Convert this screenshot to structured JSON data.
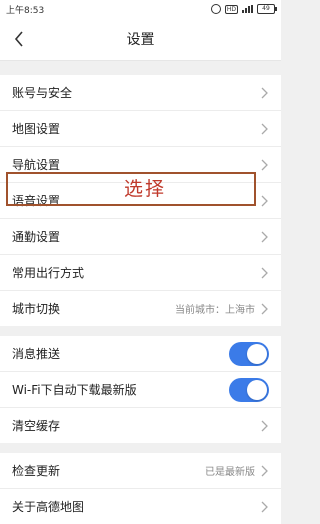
{
  "status_bar": {
    "time": "上午8:53",
    "hd_label": "HD",
    "battery": "49"
  },
  "header": {
    "title": "设置"
  },
  "groups": [
    {
      "rows": [
        {
          "label": "账号与安全"
        },
        {
          "label": "地图设置"
        },
        {
          "label": "导航设置"
        },
        {
          "label": "语音设置"
        },
        {
          "label": "通勤设置"
        },
        {
          "label": "常用出行方式"
        },
        {
          "label": "城市切换",
          "value": "当前城市：上海市"
        }
      ]
    },
    {
      "rows": [
        {
          "label": "消息推送",
          "toggle": "on"
        },
        {
          "label": "Wi-Fi下自动下载最新版",
          "toggle": "on"
        },
        {
          "label": "清空缓存"
        }
      ]
    },
    {
      "rows": [
        {
          "label": "检查更新",
          "value": "已是最新版"
        },
        {
          "label": "关于高德地图"
        }
      ]
    }
  ],
  "annotation": {
    "text": "选择",
    "color": "#c0392b"
  },
  "colors": {
    "toggle_on": "#3b7be8",
    "highlight_border": "#a0522d"
  }
}
